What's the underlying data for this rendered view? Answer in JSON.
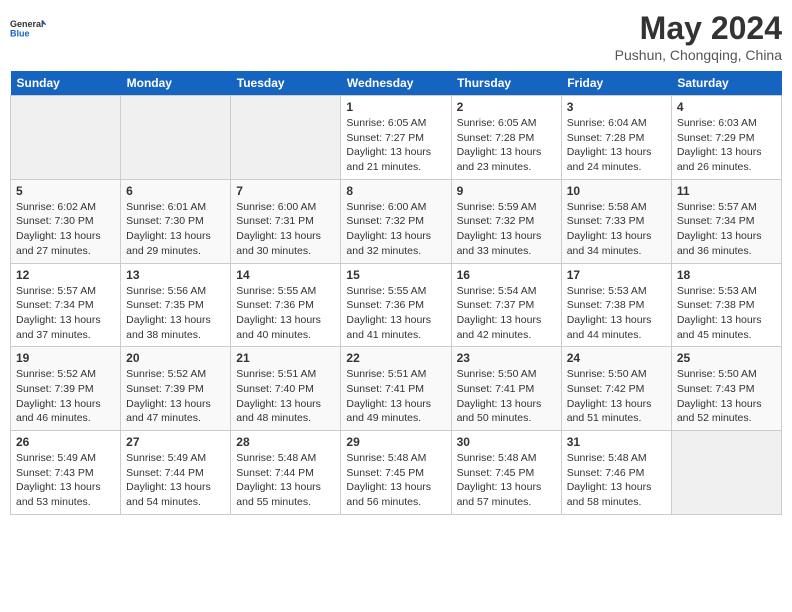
{
  "logo": {
    "line1": "General",
    "line2": "Blue"
  },
  "title": "May 2024",
  "location": "Pushun, Chongqing, China",
  "days_of_week": [
    "Sunday",
    "Monday",
    "Tuesday",
    "Wednesday",
    "Thursday",
    "Friday",
    "Saturday"
  ],
  "weeks": [
    [
      {
        "num": "",
        "info": ""
      },
      {
        "num": "",
        "info": ""
      },
      {
        "num": "",
        "info": ""
      },
      {
        "num": "1",
        "info": "Sunrise: 6:05 AM\nSunset: 7:27 PM\nDaylight: 13 hours\nand 21 minutes."
      },
      {
        "num": "2",
        "info": "Sunrise: 6:05 AM\nSunset: 7:28 PM\nDaylight: 13 hours\nand 23 minutes."
      },
      {
        "num": "3",
        "info": "Sunrise: 6:04 AM\nSunset: 7:28 PM\nDaylight: 13 hours\nand 24 minutes."
      },
      {
        "num": "4",
        "info": "Sunrise: 6:03 AM\nSunset: 7:29 PM\nDaylight: 13 hours\nand 26 minutes."
      }
    ],
    [
      {
        "num": "5",
        "info": "Sunrise: 6:02 AM\nSunset: 7:30 PM\nDaylight: 13 hours\nand 27 minutes."
      },
      {
        "num": "6",
        "info": "Sunrise: 6:01 AM\nSunset: 7:30 PM\nDaylight: 13 hours\nand 29 minutes."
      },
      {
        "num": "7",
        "info": "Sunrise: 6:00 AM\nSunset: 7:31 PM\nDaylight: 13 hours\nand 30 minutes."
      },
      {
        "num": "8",
        "info": "Sunrise: 6:00 AM\nSunset: 7:32 PM\nDaylight: 13 hours\nand 32 minutes."
      },
      {
        "num": "9",
        "info": "Sunrise: 5:59 AM\nSunset: 7:32 PM\nDaylight: 13 hours\nand 33 minutes."
      },
      {
        "num": "10",
        "info": "Sunrise: 5:58 AM\nSunset: 7:33 PM\nDaylight: 13 hours\nand 34 minutes."
      },
      {
        "num": "11",
        "info": "Sunrise: 5:57 AM\nSunset: 7:34 PM\nDaylight: 13 hours\nand 36 minutes."
      }
    ],
    [
      {
        "num": "12",
        "info": "Sunrise: 5:57 AM\nSunset: 7:34 PM\nDaylight: 13 hours\nand 37 minutes."
      },
      {
        "num": "13",
        "info": "Sunrise: 5:56 AM\nSunset: 7:35 PM\nDaylight: 13 hours\nand 38 minutes."
      },
      {
        "num": "14",
        "info": "Sunrise: 5:55 AM\nSunset: 7:36 PM\nDaylight: 13 hours\nand 40 minutes."
      },
      {
        "num": "15",
        "info": "Sunrise: 5:55 AM\nSunset: 7:36 PM\nDaylight: 13 hours\nand 41 minutes."
      },
      {
        "num": "16",
        "info": "Sunrise: 5:54 AM\nSunset: 7:37 PM\nDaylight: 13 hours\nand 42 minutes."
      },
      {
        "num": "17",
        "info": "Sunrise: 5:53 AM\nSunset: 7:38 PM\nDaylight: 13 hours\nand 44 minutes."
      },
      {
        "num": "18",
        "info": "Sunrise: 5:53 AM\nSunset: 7:38 PM\nDaylight: 13 hours\nand 45 minutes."
      }
    ],
    [
      {
        "num": "19",
        "info": "Sunrise: 5:52 AM\nSunset: 7:39 PM\nDaylight: 13 hours\nand 46 minutes."
      },
      {
        "num": "20",
        "info": "Sunrise: 5:52 AM\nSunset: 7:39 PM\nDaylight: 13 hours\nand 47 minutes."
      },
      {
        "num": "21",
        "info": "Sunrise: 5:51 AM\nSunset: 7:40 PM\nDaylight: 13 hours\nand 48 minutes."
      },
      {
        "num": "22",
        "info": "Sunrise: 5:51 AM\nSunset: 7:41 PM\nDaylight: 13 hours\nand 49 minutes."
      },
      {
        "num": "23",
        "info": "Sunrise: 5:50 AM\nSunset: 7:41 PM\nDaylight: 13 hours\nand 50 minutes."
      },
      {
        "num": "24",
        "info": "Sunrise: 5:50 AM\nSunset: 7:42 PM\nDaylight: 13 hours\nand 51 minutes."
      },
      {
        "num": "25",
        "info": "Sunrise: 5:50 AM\nSunset: 7:43 PM\nDaylight: 13 hours\nand 52 minutes."
      }
    ],
    [
      {
        "num": "26",
        "info": "Sunrise: 5:49 AM\nSunset: 7:43 PM\nDaylight: 13 hours\nand 53 minutes."
      },
      {
        "num": "27",
        "info": "Sunrise: 5:49 AM\nSunset: 7:44 PM\nDaylight: 13 hours\nand 54 minutes."
      },
      {
        "num": "28",
        "info": "Sunrise: 5:48 AM\nSunset: 7:44 PM\nDaylight: 13 hours\nand 55 minutes."
      },
      {
        "num": "29",
        "info": "Sunrise: 5:48 AM\nSunset: 7:45 PM\nDaylight: 13 hours\nand 56 minutes."
      },
      {
        "num": "30",
        "info": "Sunrise: 5:48 AM\nSunset: 7:45 PM\nDaylight: 13 hours\nand 57 minutes."
      },
      {
        "num": "31",
        "info": "Sunrise: 5:48 AM\nSunset: 7:46 PM\nDaylight: 13 hours\nand 58 minutes."
      },
      {
        "num": "",
        "info": ""
      }
    ]
  ]
}
